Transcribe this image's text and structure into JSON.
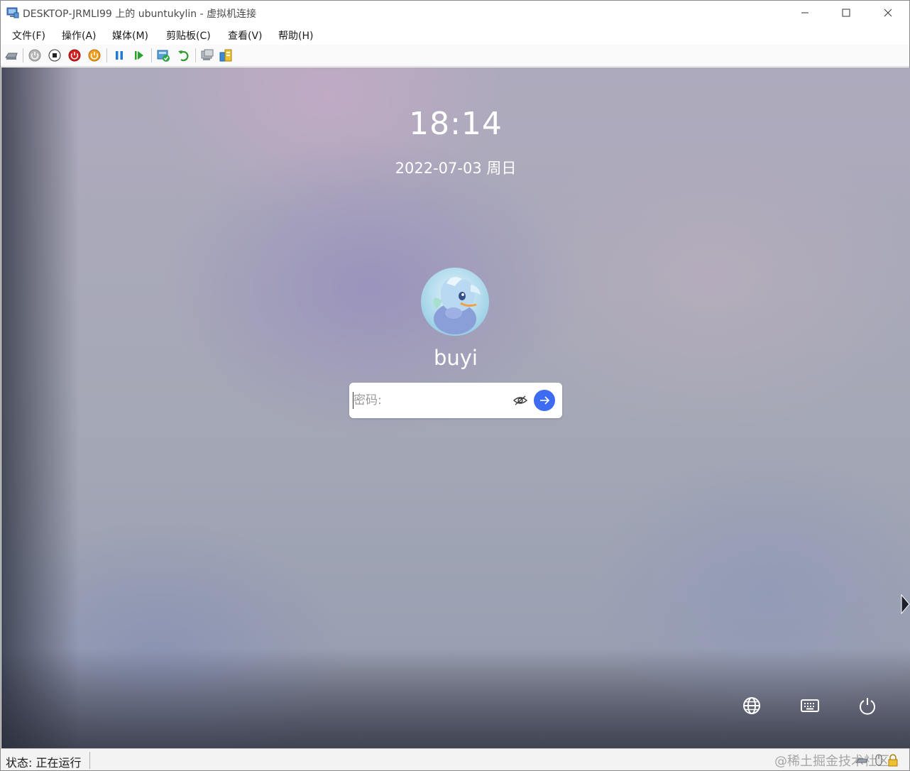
{
  "window": {
    "title": "DESKTOP-JRMLI99 上的 ubuntukylin - 虚拟机连接",
    "minimize_icon": "minimize-icon",
    "maximize_icon": "maximize-icon",
    "close_icon": "close-icon"
  },
  "menu": {
    "items": [
      {
        "label": "文件(F)"
      },
      {
        "label": "操作(A)"
      },
      {
        "label": "媒体(M)"
      },
      {
        "label": "剪贴板(C)"
      },
      {
        "label": "查看(V)"
      },
      {
        "label": "帮助(H)"
      }
    ]
  },
  "toolbar": {
    "icons": [
      "ctrl-alt-del-icon",
      "start-icon",
      "turn-off-icon",
      "shut-down-icon",
      "save-icon",
      "pause-icon",
      "resume-icon",
      "checkpoint-icon",
      "revert-icon",
      "enhanced-session-icon",
      "share-icon"
    ]
  },
  "lock_screen": {
    "time": "18:14",
    "date": "2022-07-03 周日",
    "username": "buyi",
    "password_placeholder": "密码:",
    "accent_color": "#3d6bf2",
    "bottom_icons": [
      "language-globe-icon",
      "keyboard-icon",
      "power-icon"
    ]
  },
  "status": {
    "text": "状态: 正在运行",
    "watermark": "@稀土掘金技术社区"
  }
}
